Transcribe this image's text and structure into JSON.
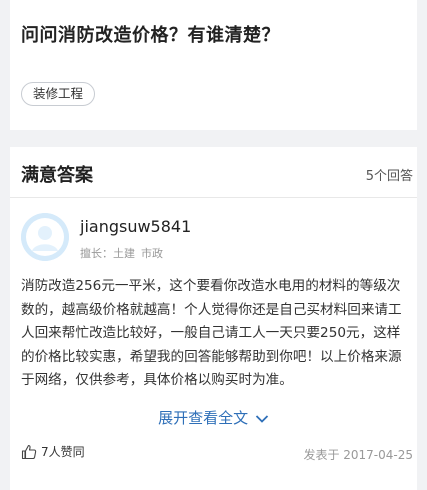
{
  "question": {
    "title": "问问消防改造价格？有谁清楚？",
    "tag": "装修工程"
  },
  "answer_section": {
    "title": "满意答案",
    "count": "5个回答",
    "user": {
      "name": "jiangsuw5841",
      "expertise_label": "擅长：",
      "expertise": [
        "土建",
        "市政"
      ]
    },
    "content": "消防改造256元一平米，这个要看你改造水电用的材料的等级次数的，越高级价格就越高！个人觉得你还是自己买材料回来请工人回来帮忙改造比较好，一般自己请工人一天只要250元，这样的价格比较实惠，希望我的回答能够帮助到你吧！以上价格来源于网络，仅供参考，具体价格以购买时为准。",
    "expand_label": "展开查看全文",
    "likes": "7人赞同",
    "date": "发表于 2017-04-25"
  },
  "colors": {
    "link": "#2e6fb8",
    "background": "#f1f2f4",
    "avatar_bg": "#d5eafa"
  }
}
